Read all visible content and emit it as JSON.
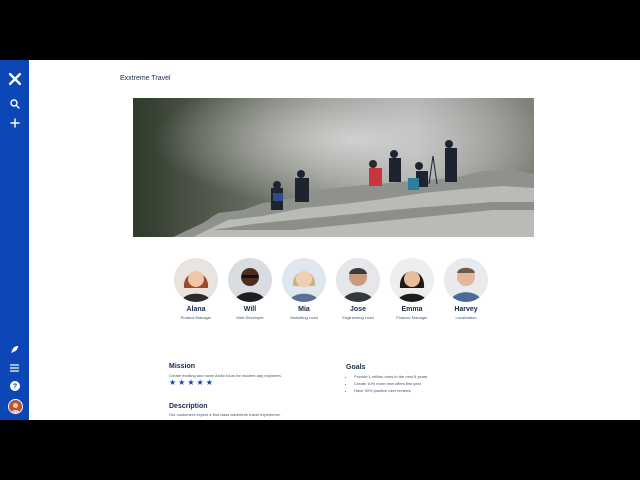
{
  "page": {
    "title": "Exxtreme Travel"
  },
  "sidebar": {
    "icons": [
      "app-logo-icon",
      "search-icon",
      "plus-icon",
      "rocket-icon",
      "menu-icon",
      "help-icon",
      "user-avatar"
    ]
  },
  "team": [
    {
      "name": "Alana",
      "role": "Product Manager"
    },
    {
      "name": "Will",
      "role": "Web Developer"
    },
    {
      "name": "Mia",
      "role": "Marketing Lead"
    },
    {
      "name": "Jose",
      "role": "Engineering Lead"
    },
    {
      "name": "Emma",
      "role": "Finance Manager"
    },
    {
      "name": "Harvey",
      "role": "Localization"
    }
  ],
  "mission": {
    "heading": "Mission",
    "text": "Create exciting and novel Arctic tours for modern-day explorers.",
    "rating": 5
  },
  "goals": {
    "heading": "Goals",
    "items": [
      "Provide 1 million tours in the next 5 years",
      "Create 10% more new offers this year",
      "Have 90% positive user reviews"
    ]
  },
  "description": {
    "heading": "Description",
    "text": "Our customers expect a first class adventure travel experience."
  },
  "colors": {
    "sidebar": "#0d47b7",
    "star": "#0d47b7",
    "text": "#172b4d"
  }
}
